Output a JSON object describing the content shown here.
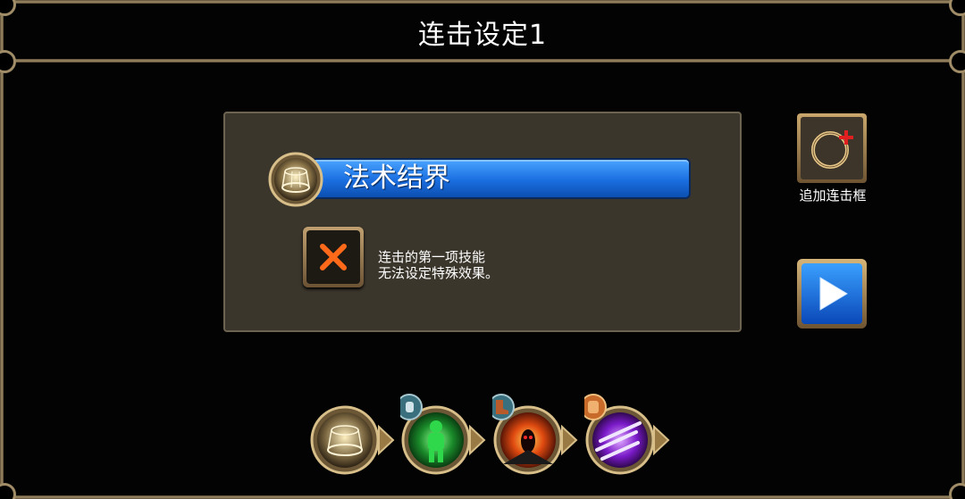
{
  "header": {
    "title": "连击设定1"
  },
  "panel": {
    "skill_name": "法术结界",
    "note_line1": "连击的第一项技能",
    "note_line2": "无法设定特殊效果。"
  },
  "side": {
    "add_frame_label": "追加连击框"
  },
  "combo_skills": [
    {
      "name": "arcane-barrier-skill-icon",
      "badge": ""
    },
    {
      "name": "green-spirit-skill-icon",
      "badge": "potion-badge-icon"
    },
    {
      "name": "dark-flame-skill-icon",
      "badge": "boot-badge-icon"
    },
    {
      "name": "purple-blades-skill-icon",
      "badge": "gauntlet-badge-icon"
    }
  ],
  "colors": {
    "bar_blue": "#1a6ee0",
    "panel_bg": "#3b362c",
    "frame_gold": "#a08c66",
    "x_orange": "#ff6a1a"
  }
}
